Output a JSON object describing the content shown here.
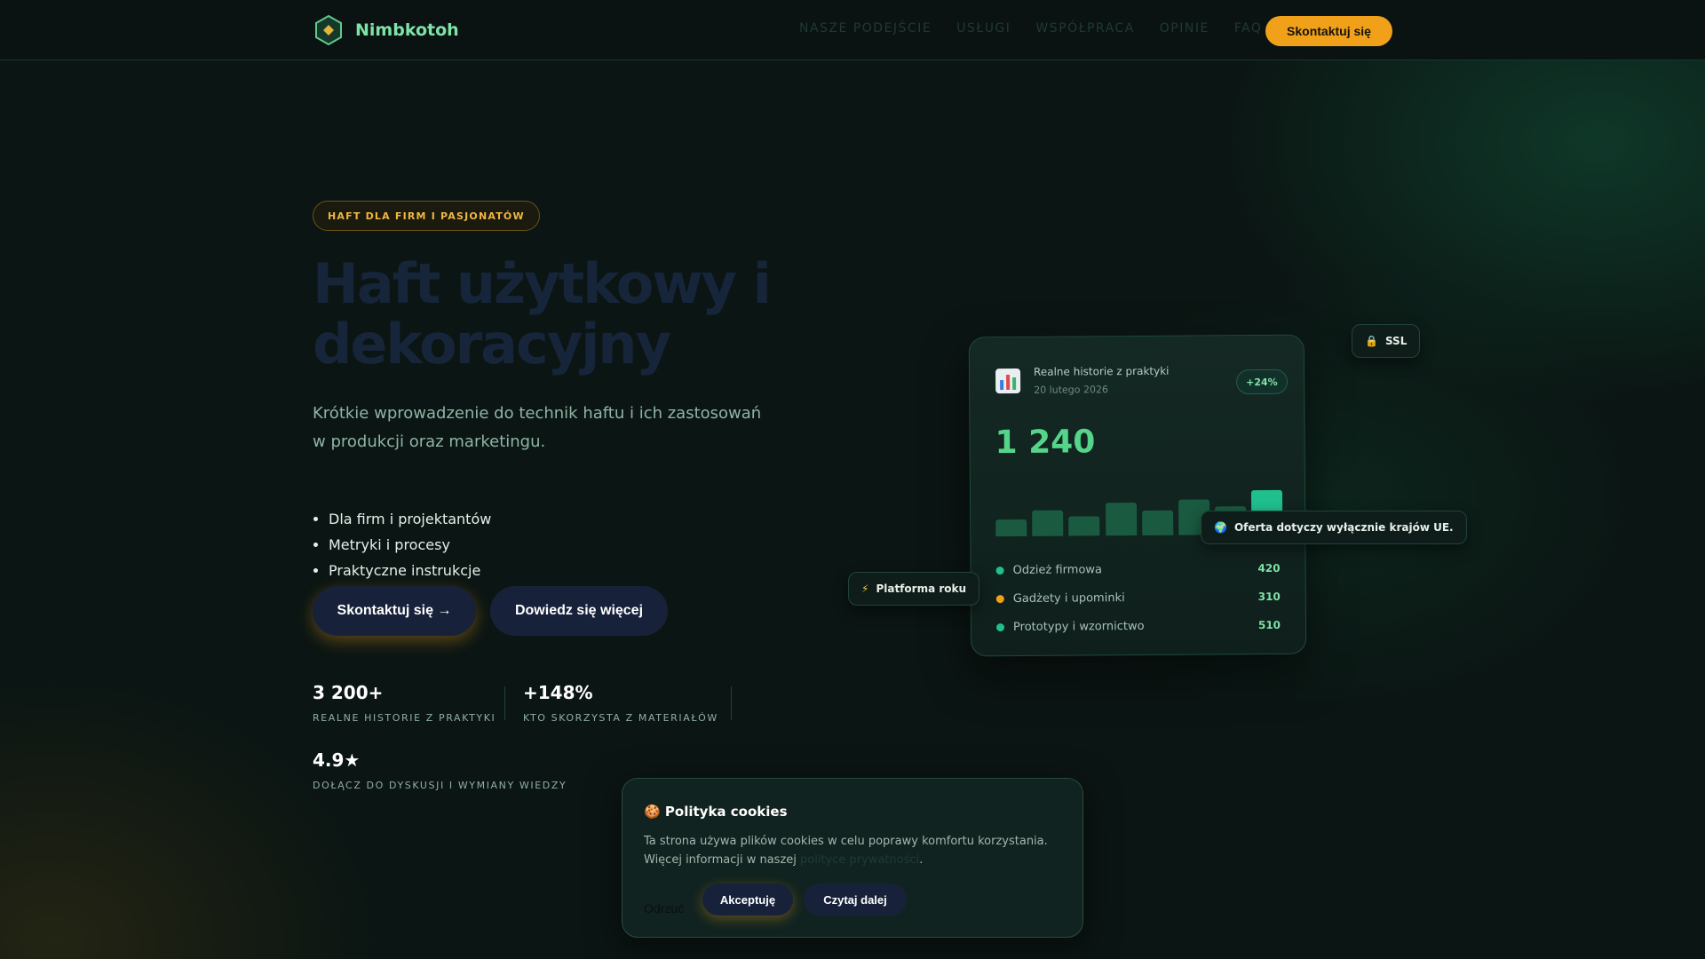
{
  "brand": {
    "name": "Nimbkotoh",
    "accent": "#f0a019",
    "green": "#54d58a",
    "logo_icon": "hexagon-logo-icon"
  },
  "nav": {
    "links": [
      "NASZE PODEJŚCIE",
      "USŁUGI",
      "WSPÓŁPRACA",
      "OPINIE",
      "FAQ"
    ],
    "cta": "Skontaktuj się"
  },
  "hero": {
    "badge": "HAFT DLA FIRM I PASJONATÓW",
    "title": "Haft użytkowy i dekoracyjny",
    "subtitle": "Krótkie wprowadzenie do technik haftu i ich zastosowań w produkcji oraz marketingu.",
    "bullets": [
      "Dla firm i projektantów",
      "Metryki i procesy",
      "Praktyczne instrukcje"
    ],
    "primary_button": "Skontaktuj się →",
    "secondary_button": "Dowiedz się więcej"
  },
  "stats": [
    {
      "value": "3 200+",
      "label": "REALNE HISTORIE Z PRAKTYKI"
    },
    {
      "value": "+148%",
      "label": "KTO SKORZYSTA Z MATERIAŁÓW"
    },
    {
      "value": "4.9★",
      "label": "DOŁĄCZ DO DYSKUSJI I WYMIANY WIEDZY"
    }
  ],
  "dashboard": {
    "icon": "bar-chart-icon",
    "title": "Realne historie z praktyki",
    "date": "20 lutego 2026",
    "change": "+24%",
    "value": "1 240",
    "bars": [
      0.3,
      0.46,
      0.34,
      0.58,
      0.43,
      0.62,
      0.5,
      0.78
    ],
    "legend": [
      {
        "label": "Odzież firmowa",
        "value": "420",
        "color": "#1fbf8e"
      },
      {
        "label": "Gadżety i upominki",
        "value": "310",
        "color": "#f0a019"
      },
      {
        "label": "Prototypy i wzornictwo",
        "value": "510",
        "color": "#1fbf8e"
      }
    ]
  },
  "chips": {
    "ssl": {
      "icon": "lock-icon",
      "label": "SSL"
    },
    "eu": {
      "icon": "globe-icon",
      "label": "Oferta dotyczy wyłącznie krajów UE."
    },
    "platform": {
      "icon": "lightning-icon",
      "label": "Platforma roku"
    }
  },
  "cookie": {
    "icon": "cookie-icon",
    "title": "Polityka cookies",
    "text": "Ta strona używa plików cookies w celu poprawy komfortu korzystania. Więcej informacji w naszej",
    "link": "polityce prywatności",
    "text_end": ".",
    "reject": "Odrzuć",
    "accept": "Akceptuję",
    "more": "Czytaj dalej"
  }
}
